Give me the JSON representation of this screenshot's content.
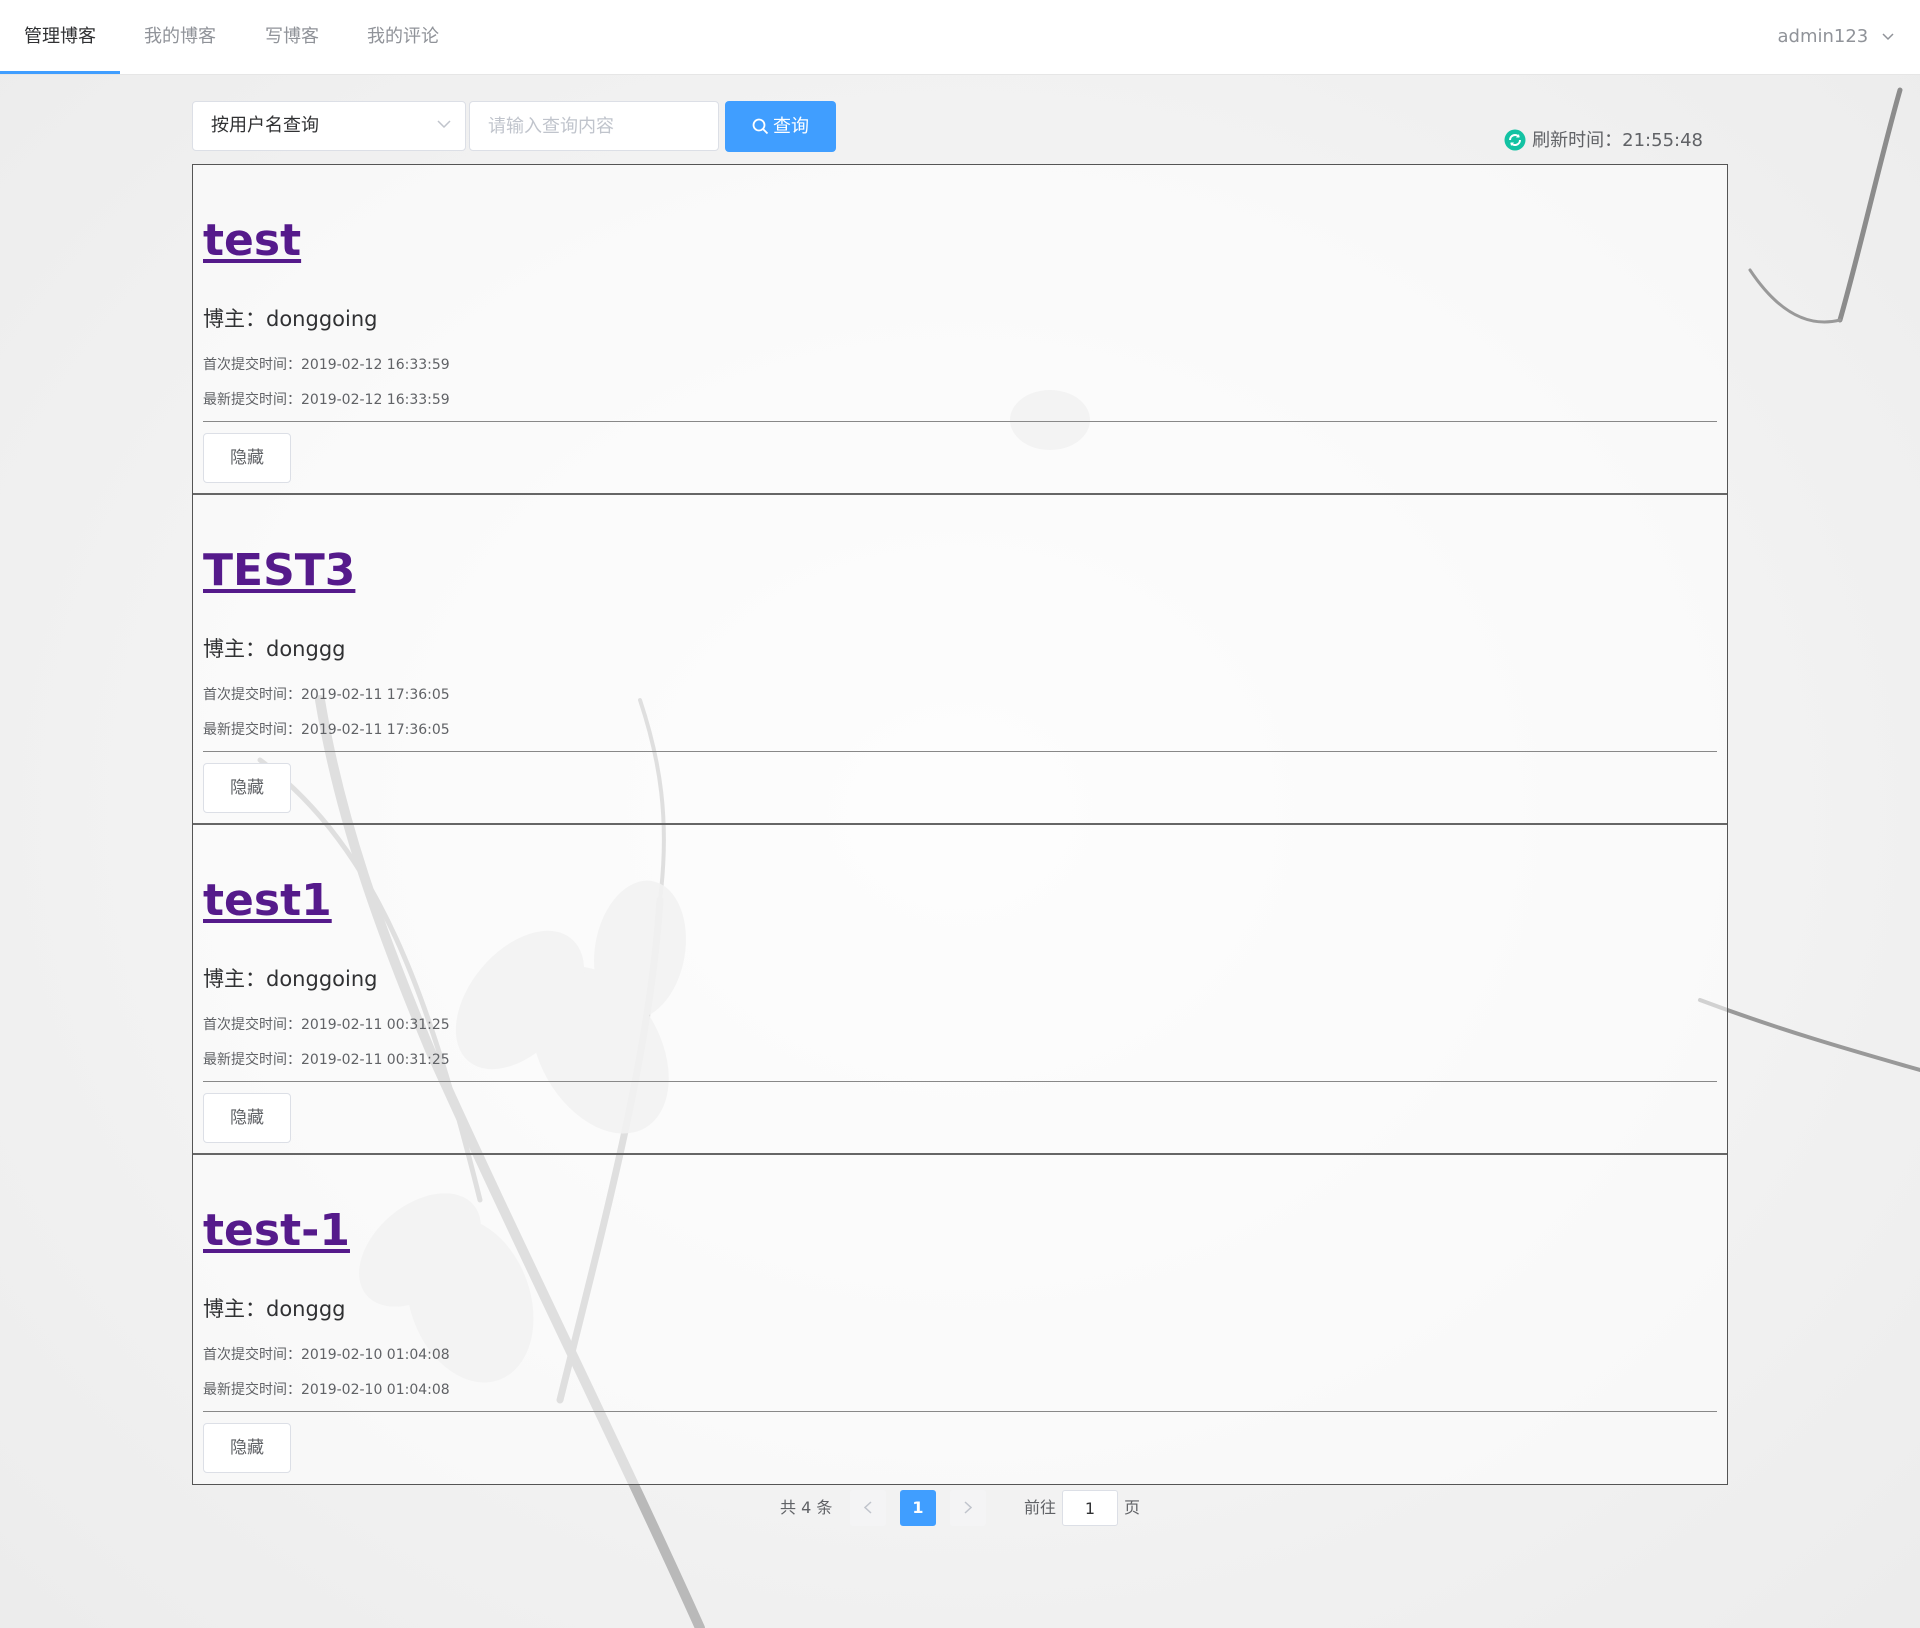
{
  "nav": {
    "tabs": [
      {
        "label": "管理博客",
        "active": true
      },
      {
        "label": "我的博客"
      },
      {
        "label": "写博客"
      },
      {
        "label": "我的评论"
      }
    ],
    "user": "admin123"
  },
  "search": {
    "select_value": "按用户名查询",
    "placeholder": "请输入查询内容",
    "button_label": "查询"
  },
  "refresh": {
    "label": "刷新时间：",
    "time": "21:55:48"
  },
  "posts": [
    {
      "title": "test",
      "author_label": "博主：",
      "author": "donggoing",
      "first_label": "首次提交时间：",
      "first": "2019-02-12 16:33:59",
      "latest_label": "最新提交时间：",
      "latest": "2019-02-12 16:33:59",
      "hide_label": "隐藏"
    },
    {
      "title": "TEST3",
      "author_label": "博主：",
      "author": "donggg",
      "first_label": "首次提交时间：",
      "first": "2019-02-11 17:36:05",
      "latest_label": "最新提交时间：",
      "latest": "2019-02-11 17:36:05",
      "hide_label": "隐藏"
    },
    {
      "title": "test1",
      "author_label": "博主：",
      "author": "donggoing",
      "first_label": "首次提交时间：",
      "first": "2019-02-11 00:31:25",
      "latest_label": "最新提交时间：",
      "latest": "2019-02-11 00:31:25",
      "hide_label": "隐藏"
    },
    {
      "title": "test-1",
      "author_label": "博主：",
      "author": "donggg",
      "first_label": "首次提交时间：",
      "first": "2019-02-10 01:04:08",
      "latest_label": "最新提交时间：",
      "latest": "2019-02-10 01:04:08",
      "hide_label": "隐藏"
    }
  ],
  "pagination": {
    "total": "共 4 条",
    "current": "1",
    "goto_label": "前往",
    "goto_value": "1",
    "page_unit": "页"
  },
  "colors": {
    "accent": "#409eff",
    "link_visited": "#551a8b",
    "refresh_icon": "#13c2a3"
  }
}
